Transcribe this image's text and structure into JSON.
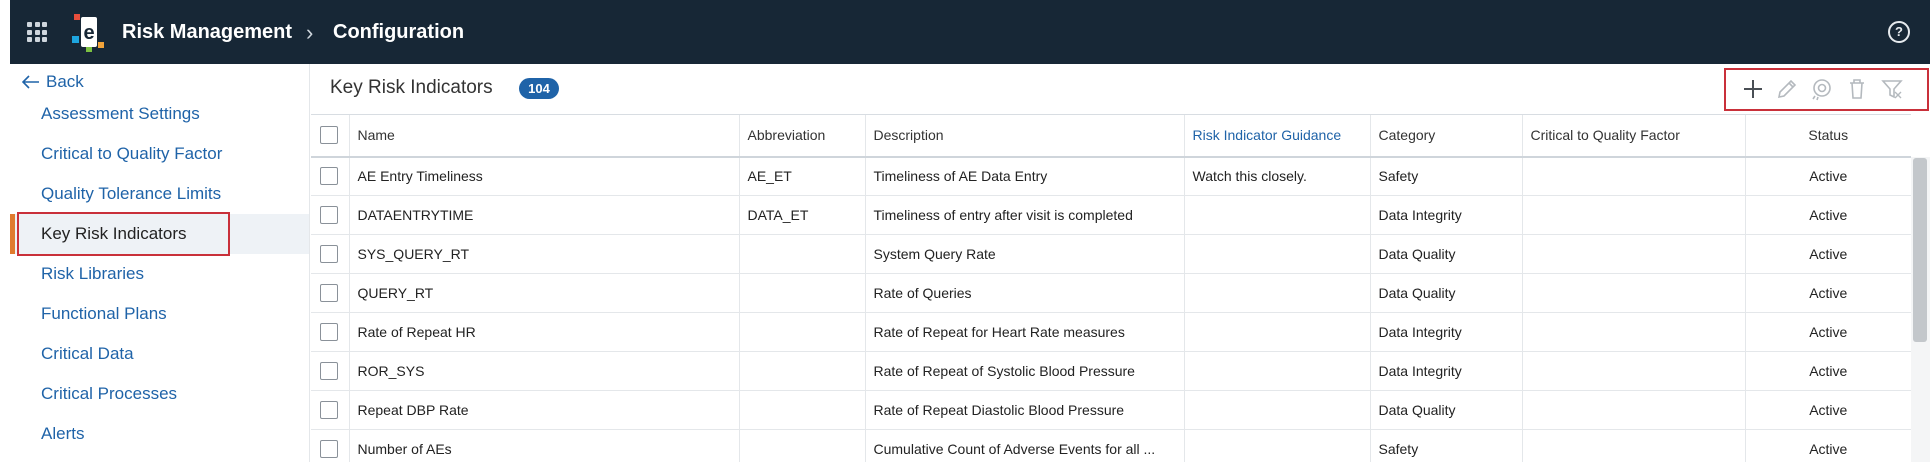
{
  "topbar": {
    "app_title": "Risk Management",
    "breadcrumb_sep": "›",
    "crumb": "Configuration",
    "help_symbol": "?"
  },
  "sidebar": {
    "back_label": "Back",
    "items": [
      {
        "label": "Assessment Settings"
      },
      {
        "label": "Critical to Quality Factor"
      },
      {
        "label": "Quality Tolerance Limits"
      },
      {
        "label": "Key Risk Indicators",
        "active": true
      },
      {
        "label": "Risk Libraries"
      },
      {
        "label": "Functional Plans"
      },
      {
        "label": "Critical Data"
      },
      {
        "label": "Critical Processes"
      },
      {
        "label": "Alerts"
      }
    ]
  },
  "main": {
    "title": "Key Risk Indicators",
    "count": "104",
    "toolbar_icons": [
      "add-icon",
      "edit-icon",
      "copy-icon",
      "delete-icon",
      "filter-icon"
    ]
  },
  "table": {
    "columns": [
      "Name",
      "Abbreviation",
      "Description",
      "Risk Indicator Guidance",
      "Category",
      "Critical to Quality Factor",
      "Status"
    ],
    "rows": [
      [
        "AE Entry Timeliness",
        "AE_ET",
        "Timeliness of AE Data Entry",
        "Watch this closely.",
        "Safety",
        "",
        "Active"
      ],
      [
        "DATAENTRYTIME",
        "DATA_ET",
        "Timeliness of entry after visit is completed",
        "",
        "Data Integrity",
        "",
        "Active"
      ],
      [
        "SYS_QUERY_RT",
        "",
        "System Query Rate",
        "",
        "Data Quality",
        "",
        "Active"
      ],
      [
        "QUERY_RT",
        "",
        "Rate of Queries",
        "",
        "Data Quality",
        "",
        "Active"
      ],
      [
        "Rate of Repeat HR",
        "",
        "Rate of Repeat for Heart Rate measures",
        "",
        "Data Integrity",
        "",
        "Active"
      ],
      [
        "ROR_SYS",
        "",
        "Rate of Repeat of Systolic Blood Pressure",
        "",
        "Data Integrity",
        "",
        "Active"
      ],
      [
        "Repeat DBP Rate",
        "",
        "Rate of Repeat Diastolic Blood Pressure",
        "",
        "Data Quality",
        "",
        "Active"
      ],
      [
        "Number of AEs",
        "",
        "Cumulative Count of Adverse Events for all ...",
        "",
        "Safety",
        "",
        "Active"
      ]
    ]
  },
  "colors": {
    "topbar_bg": "#172736",
    "link_blue": "#1f63a8",
    "active_accent": "#e07b2e",
    "highlight_red": "#c9303a"
  }
}
